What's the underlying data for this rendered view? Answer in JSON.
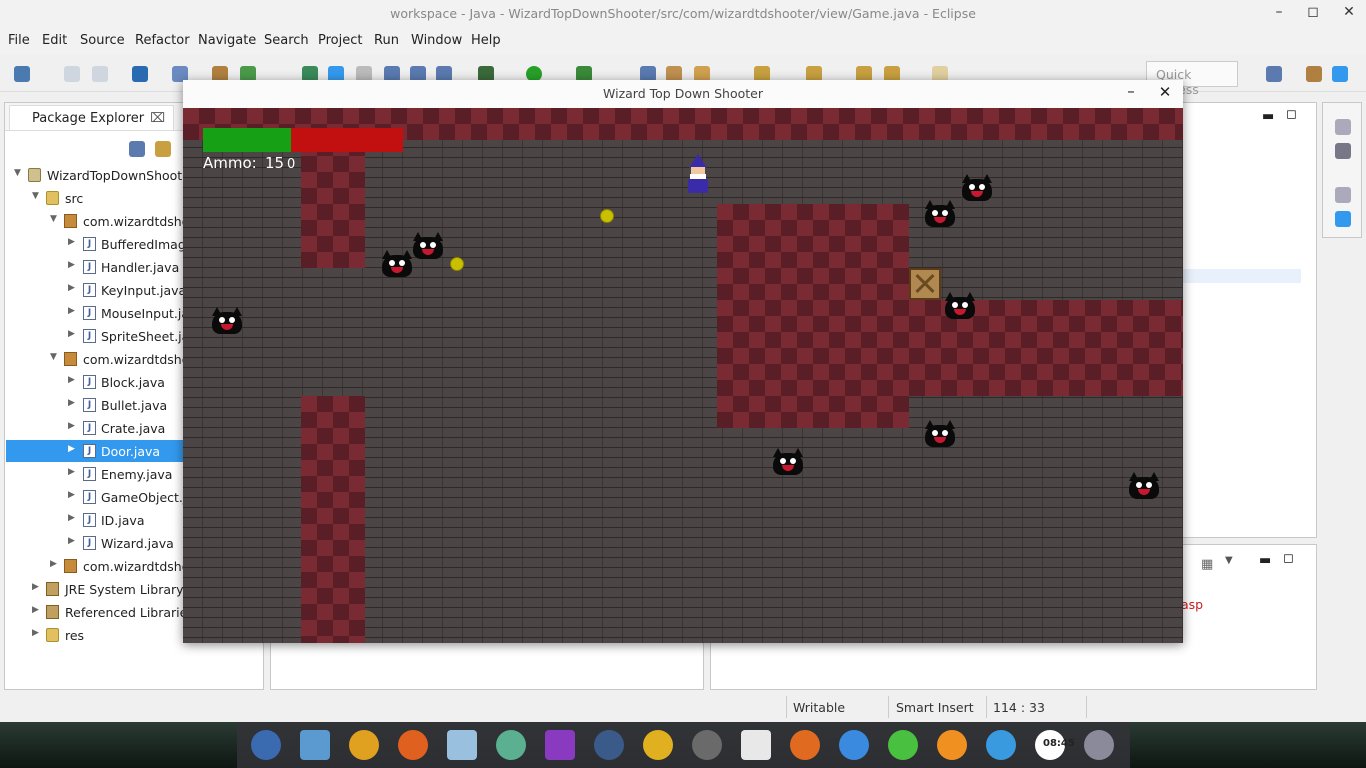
{
  "eclipse": {
    "title": "workspace - Java - WizardTopDownShooter/src/com/wizardtdshooter/view/Game.java - Eclipse",
    "menu": [
      "File",
      "Edit",
      "Source",
      "Refactor",
      "Navigate",
      "Search",
      "Project",
      "Run",
      "Window",
      "Help"
    ],
    "quick_access": "Quick Access",
    "package_explorer": {
      "tab_label": "Package Explorer",
      "items": [
        {
          "label": "WizardTopDownShooter",
          "icon": "project-icon",
          "expanded": true
        },
        {
          "label": "src",
          "icon": "source-folder-icon",
          "expanded": true
        },
        {
          "label": "com.wizardtdshooter.",
          "icon": "package-icon",
          "expanded": true
        },
        {
          "label": "BufferedImageLoader.java",
          "icon": "java-file-icon",
          "expanded": false
        },
        {
          "label": "Handler.java",
          "icon": "java-file-icon",
          "expanded": false
        },
        {
          "label": "KeyInput.java",
          "icon": "java-file-icon",
          "expanded": false
        },
        {
          "label": "MouseInput.java",
          "icon": "java-file-icon",
          "expanded": false
        },
        {
          "label": "SpriteSheet.java",
          "icon": "java-file-icon",
          "expanded": false
        },
        {
          "label": "com.wizardtdshooter.",
          "icon": "package-icon",
          "expanded": true
        },
        {
          "label": "Block.java",
          "icon": "java-file-icon",
          "expanded": false
        },
        {
          "label": "Bullet.java",
          "icon": "java-file-icon",
          "expanded": false
        },
        {
          "label": "Crate.java",
          "icon": "java-file-icon",
          "expanded": false
        },
        {
          "label": "Door.java",
          "icon": "java-file-icon",
          "expanded": false,
          "selected": true
        },
        {
          "label": "Enemy.java",
          "icon": "java-file-icon",
          "expanded": false
        },
        {
          "label": "GameObject.java",
          "icon": "java-file-icon",
          "expanded": false
        },
        {
          "label": "ID.java",
          "icon": "java-file-icon",
          "expanded": false
        },
        {
          "label": "Wizard.java",
          "icon": "java-file-icon",
          "expanded": false
        },
        {
          "label": "com.wizardtdshooter.",
          "icon": "package-icon",
          "expanded": false
        },
        {
          "label": "JRE System Library [Ja",
          "icon": "library-icon",
          "expanded": false
        },
        {
          "label": "Referenced Libraries",
          "icon": "library-icon",
          "expanded": false
        },
        {
          "label": "res",
          "icon": "folder-icon",
          "expanded": false
        }
      ]
    },
    "console_partial_text": "asp",
    "status": {
      "writable": "Writable",
      "insert_mode": "Smart Insert",
      "cursor_position": "114 : 33"
    }
  },
  "game": {
    "window_title": "Wizard Top Down Shooter",
    "hud": {
      "health_fraction": 0.44,
      "ammo_label": "Ammo:",
      "ammo_value": "15",
      "score_value": "0",
      "health_color": "#16a016",
      "damage_color": "#c21010"
    },
    "enemy_count": 10,
    "coin_count": 2
  },
  "taskbar": {
    "clock": "08:45"
  }
}
